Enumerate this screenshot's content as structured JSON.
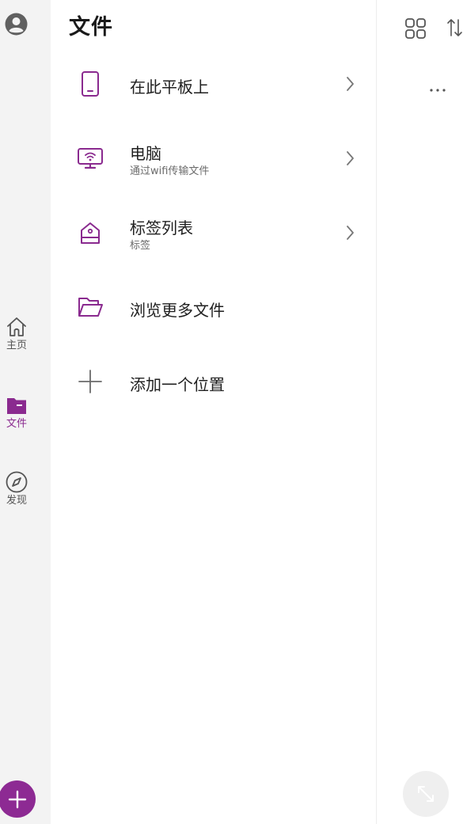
{
  "rail": {
    "items": [
      {
        "label": "主页",
        "icon": "home-icon"
      },
      {
        "label": "文件",
        "icon": "folder-icon",
        "active": true
      },
      {
        "label": "发现",
        "icon": "compass-icon"
      }
    ],
    "fab_icon": "plus-icon"
  },
  "pane": {
    "title": "文件",
    "rows": [
      {
        "title": "在此平板上",
        "subtitle": "",
        "icon": "tablet-icon",
        "chevron": true
      },
      {
        "title": "电脑",
        "subtitle": "通过wifi传输文件",
        "icon": "wifi-monitor-icon",
        "chevron": true
      },
      {
        "title": "标签列表",
        "subtitle": "标签",
        "icon": "tag-icon",
        "chevron": true
      },
      {
        "title": "浏览更多文件",
        "subtitle": "",
        "icon": "folder-open-icon",
        "chevron": false
      },
      {
        "title": "添加一个位置",
        "subtitle": "",
        "icon": "plus-icon",
        "chevron": false
      }
    ]
  },
  "right": {
    "more_label": "···",
    "icons": [
      "grid-view-icon",
      "sort-icon",
      "more-icon",
      "expand-icon"
    ]
  },
  "colors": {
    "accent": "#8d2a93",
    "rail_bg": "#f3f3f3",
    "icon_purple": "#8a2a8f"
  }
}
